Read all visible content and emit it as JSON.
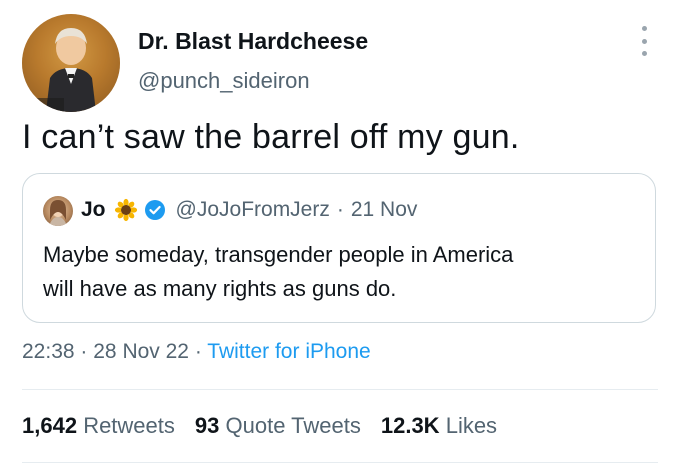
{
  "author": {
    "name": "Dr. Blast Hardcheese",
    "handle": "@punch_sideiron"
  },
  "tweet": {
    "text": "I can’t saw the barrel off my gun."
  },
  "quote": {
    "name": "Jo",
    "handle": "@JoJoFromJerz",
    "separator": "·",
    "date": "21 Nov",
    "text_line1": "Maybe someday, transgender people in America",
    "text_line2": "will have as many rights as guns do."
  },
  "meta": {
    "time": "22:38",
    "sep1": "·",
    "date": "28 Nov 22",
    "sep2": "·",
    "source": "Twitter for iPhone"
  },
  "stats": {
    "retweets_count": "1,642",
    "retweets_label": "Retweets",
    "quotes_count": "93",
    "quotes_label": "Quote Tweets",
    "likes_count": "12.3K",
    "likes_label": "Likes"
  },
  "colors": {
    "text": "#0f1419",
    "secondary": "#536471",
    "link": "#1d9bf0",
    "border": "#cfd9de"
  },
  "icons": {
    "more": "more-options-icon",
    "verified": "verified-badge-icon",
    "emoji": "sunflower-emoji-icon"
  }
}
